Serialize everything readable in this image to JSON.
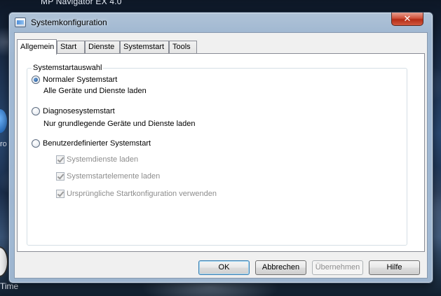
{
  "desktop": {
    "title_fragment": "MP Navigator EX 4.0",
    "side_fragment": "ro",
    "time_label": "Time"
  },
  "window": {
    "title": "Systemkonfiguration",
    "close_glyph": "✕"
  },
  "tabs": [
    {
      "label": "Allgemein",
      "active": true
    },
    {
      "label": "Start",
      "active": false
    },
    {
      "label": "Dienste",
      "active": false
    },
    {
      "label": "Systemstart",
      "active": false
    },
    {
      "label": "Tools",
      "active": false
    }
  ],
  "group": {
    "title": "Systemstartauswahl",
    "options": [
      {
        "label": "Normaler Systemstart",
        "description": "Alle Geräte und Dienste laden",
        "checked": true
      },
      {
        "label": "Diagnosesystemstart",
        "description": "Nur grundlegende Geräte und Dienste laden",
        "checked": false
      },
      {
        "label": "Benutzerdefinierter Systemstart",
        "checked": false
      }
    ],
    "sub_options": [
      {
        "label": "Systemdienste laden",
        "checked": true,
        "disabled": true
      },
      {
        "label": "Systemstartelemente laden",
        "checked": true,
        "disabled": true
      },
      {
        "label": "Ursprüngliche Startkonfiguration verwenden",
        "checked": true,
        "disabled": true
      }
    ]
  },
  "buttons": {
    "ok": "OK",
    "cancel": "Abbrechen",
    "apply": "Übernehmen",
    "help": "Hilfe"
  }
}
